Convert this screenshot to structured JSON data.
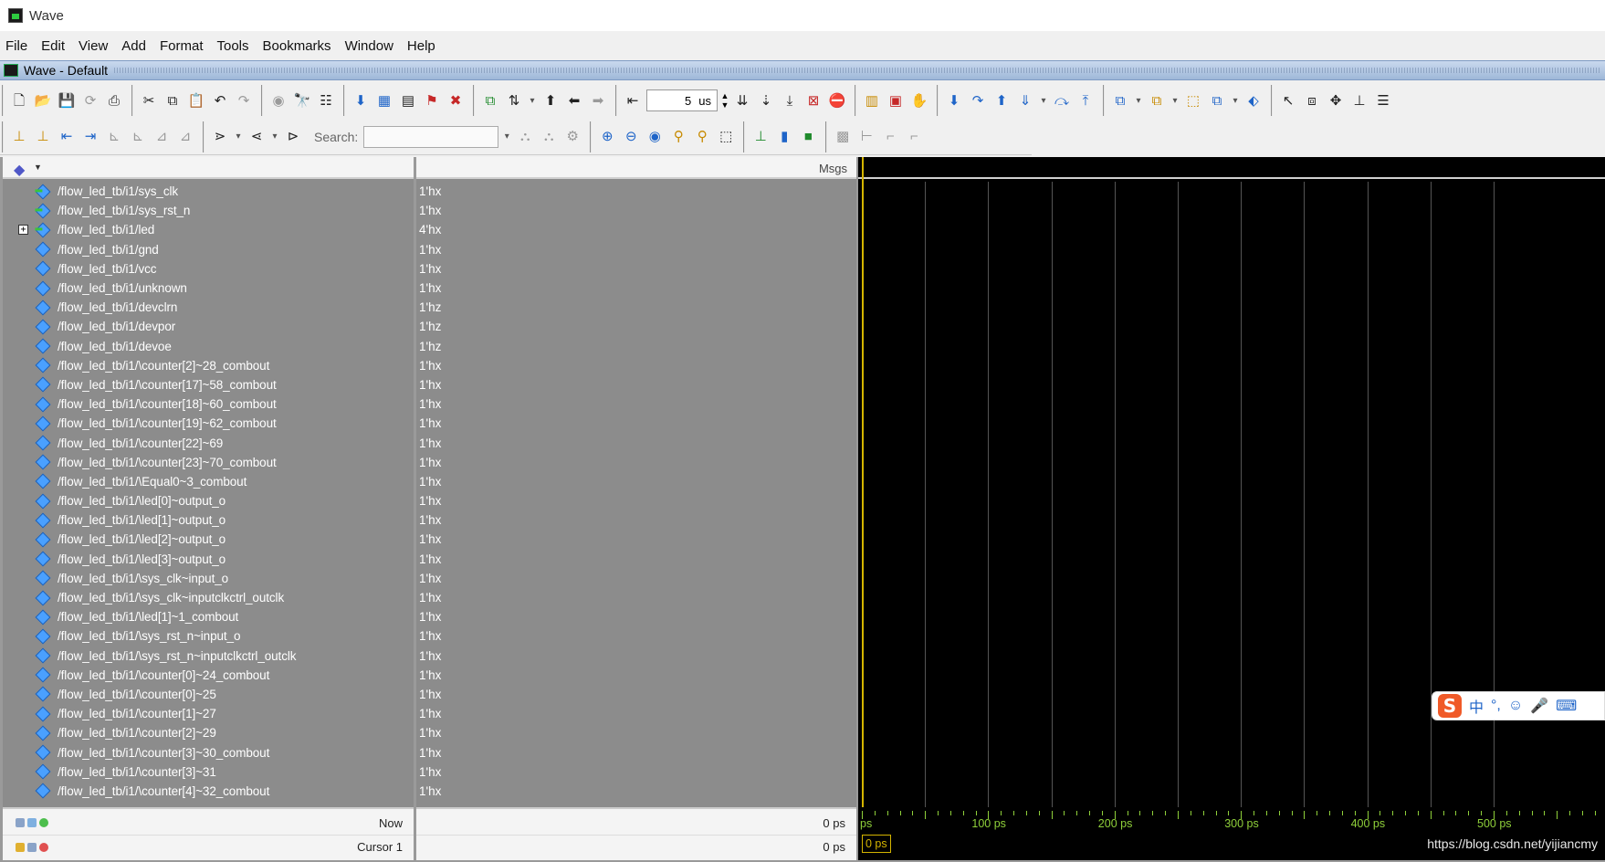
{
  "window": {
    "title": "Wave"
  },
  "menu": [
    "File",
    "Edit",
    "View",
    "Add",
    "Format",
    "Tools",
    "Bookmarks",
    "Window",
    "Help"
  ],
  "pane": {
    "title": "Wave - Default"
  },
  "toolbar": {
    "time_value": "5",
    "time_unit": "us",
    "search_label": "Search:",
    "search_placeholder": ""
  },
  "headers": {
    "msgs": "Msgs"
  },
  "signals": [
    {
      "name": "/flow_led_tb/i1/sys_clk",
      "value": "1'hx",
      "icon": "input-signal-icon"
    },
    {
      "name": "/flow_led_tb/i1/sys_rst_n",
      "value": "1'hx",
      "icon": "input-signal-icon"
    },
    {
      "name": "/flow_led_tb/i1/led",
      "value": "4'hx",
      "icon": "output-bus-icon",
      "expandable": true
    },
    {
      "name": "/flow_led_tb/i1/gnd",
      "value": "1'hx",
      "icon": "signal-icon"
    },
    {
      "name": "/flow_led_tb/i1/vcc",
      "value": "1'hx",
      "icon": "signal-icon"
    },
    {
      "name": "/flow_led_tb/i1/unknown",
      "value": "1'hx",
      "icon": "signal-icon"
    },
    {
      "name": "/flow_led_tb/i1/devclrn",
      "value": "1'hz",
      "icon": "signal-icon"
    },
    {
      "name": "/flow_led_tb/i1/devpor",
      "value": "1'hz",
      "icon": "signal-icon"
    },
    {
      "name": "/flow_led_tb/i1/devoe",
      "value": "1'hz",
      "icon": "signal-icon"
    },
    {
      "name": "/flow_led_tb/i1/\\counter[2]~28_combout",
      "value": "1'hx",
      "icon": "signal-icon"
    },
    {
      "name": "/flow_led_tb/i1/\\counter[17]~58_combout",
      "value": "1'hx",
      "icon": "signal-icon"
    },
    {
      "name": "/flow_led_tb/i1/\\counter[18]~60_combout",
      "value": "1'hx",
      "icon": "signal-icon"
    },
    {
      "name": "/flow_led_tb/i1/\\counter[19]~62_combout",
      "value": "1'hx",
      "icon": "signal-icon"
    },
    {
      "name": "/flow_led_tb/i1/\\counter[22]~69",
      "value": "1'hx",
      "icon": "signal-icon"
    },
    {
      "name": "/flow_led_tb/i1/\\counter[23]~70_combout",
      "value": "1'hx",
      "icon": "signal-icon"
    },
    {
      "name": "/flow_led_tb/i1/\\Equal0~3_combout",
      "value": "1'hx",
      "icon": "signal-icon"
    },
    {
      "name": "/flow_led_tb/i1/\\led[0]~output_o",
      "value": "1'hx",
      "icon": "signal-icon"
    },
    {
      "name": "/flow_led_tb/i1/\\led[1]~output_o",
      "value": "1'hx",
      "icon": "signal-icon"
    },
    {
      "name": "/flow_led_tb/i1/\\led[2]~output_o",
      "value": "1'hx",
      "icon": "signal-icon"
    },
    {
      "name": "/flow_led_tb/i1/\\led[3]~output_o",
      "value": "1'hx",
      "icon": "signal-icon"
    },
    {
      "name": "/flow_led_tb/i1/\\sys_clk~input_o",
      "value": "1'hx",
      "icon": "signal-icon"
    },
    {
      "name": "/flow_led_tb/i1/\\sys_clk~inputclkctrl_outclk",
      "value": "1'hx",
      "icon": "signal-icon"
    },
    {
      "name": "/flow_led_tb/i1/\\led[1]~1_combout",
      "value": "1'hx",
      "icon": "signal-icon"
    },
    {
      "name": "/flow_led_tb/i1/\\sys_rst_n~input_o",
      "value": "1'hx",
      "icon": "signal-icon"
    },
    {
      "name": "/flow_led_tb/i1/\\sys_rst_n~inputclkctrl_outclk",
      "value": "1'hx",
      "icon": "signal-icon"
    },
    {
      "name": "/flow_led_tb/i1/\\counter[0]~24_combout",
      "value": "1'hx",
      "icon": "signal-icon"
    },
    {
      "name": "/flow_led_tb/i1/\\counter[0]~25",
      "value": "1'hx",
      "icon": "signal-icon"
    },
    {
      "name": "/flow_led_tb/i1/\\counter[1]~27",
      "value": "1'hx",
      "icon": "signal-icon"
    },
    {
      "name": "/flow_led_tb/i1/\\counter[2]~29",
      "value": "1'hx",
      "icon": "signal-icon"
    },
    {
      "name": "/flow_led_tb/i1/\\counter[3]~30_combout",
      "value": "1'hx",
      "icon": "signal-icon"
    },
    {
      "name": "/flow_led_tb/i1/\\counter[3]~31",
      "value": "1'hx",
      "icon": "signal-icon"
    },
    {
      "name": "/flow_led_tb/i1/\\counter[4]~32_combout",
      "value": "1'hx",
      "icon": "signal-icon"
    }
  ],
  "bottom": {
    "now_label": "Now",
    "now_value": "0 ps",
    "cursor_label": "Cursor 1",
    "cursor_value": "0 ps",
    "cursor_badge": "0 ps"
  },
  "timeline": {
    "labels": [
      "ps",
      "100 ps",
      "200 ps",
      "300 ps",
      "400 ps",
      "500 ps"
    ],
    "color": "#8fd03a"
  },
  "cursor_color": "#d4b400",
  "watermark": "https://blog.csdn.net/yijiancmy",
  "ime": {
    "label": "中",
    "punct": "°,"
  }
}
